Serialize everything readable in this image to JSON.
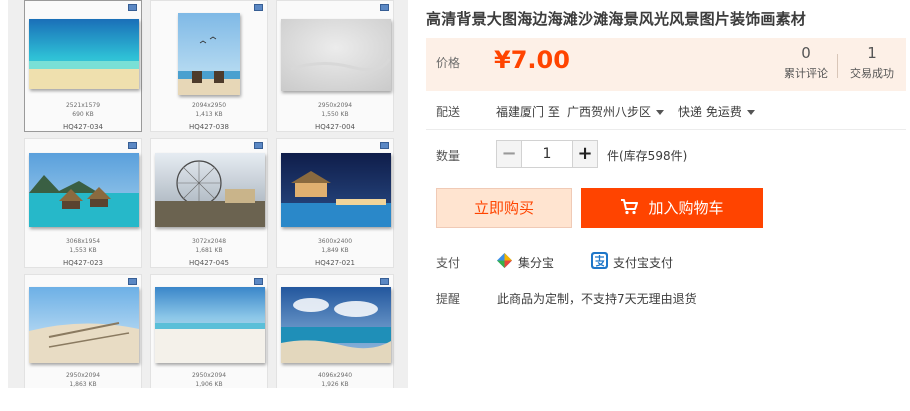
{
  "gallery": {
    "tiles": [
      {
        "dims": "2521x1579",
        "size": "690 KB",
        "code": "HQ427-034",
        "selected": true
      },
      {
        "dims": "2094x2950",
        "size": "1,413 KB",
        "code": "HQ427-038"
      },
      {
        "dims": "2950x2094",
        "size": "1,550 KB",
        "code": "HQ427-004"
      },
      {
        "dims": "3068x1954",
        "size": "1,553 KB",
        "code": "HQ427-023"
      },
      {
        "dims": "3072x2048",
        "size": "1,681 KB",
        "code": "HQ427-045"
      },
      {
        "dims": "3600x2400",
        "size": "1,849 KB",
        "code": "HQ427-021"
      },
      {
        "dims": "2950x2094",
        "size": "1,863 KB",
        "code": ""
      },
      {
        "dims": "2950x2094",
        "size": "1,906 KB",
        "code": ""
      },
      {
        "dims": "4096x2940",
        "size": "1,926 KB",
        "code": ""
      }
    ]
  },
  "product": {
    "title": "高清背景大图海边海滩沙滩海景风光风景图片装饰画素材",
    "price_label": "价格",
    "price": "¥7.00",
    "stats": [
      {
        "value": "0",
        "label": "累计评论"
      },
      {
        "value": "1",
        "label": "交易成功"
      }
    ],
    "shipping": {
      "label": "配送",
      "from": "福建厦门 至",
      "to": "广西贺州八步区",
      "method": "快递 免运费"
    },
    "quantity": {
      "label": "数量",
      "minus": "−",
      "value": "1",
      "plus": "+",
      "stock": "件(库存598件)"
    },
    "buy_now_label": "立即购买",
    "add_cart_label": "加入购物车",
    "payment": {
      "label": "支付",
      "methods": [
        {
          "name": "集分宝",
          "icon": "jifenbao-icon"
        },
        {
          "name": "支付宝支付",
          "icon": "alipay-icon"
        }
      ]
    },
    "reminder": {
      "label": "提醒",
      "text": "此商品为定制，不支持7天无理由退货"
    }
  },
  "colors": {
    "accent": "#ff4400",
    "price_bg": "#fdf0e7",
    "buy_now_bg": "#ffe4d0"
  }
}
